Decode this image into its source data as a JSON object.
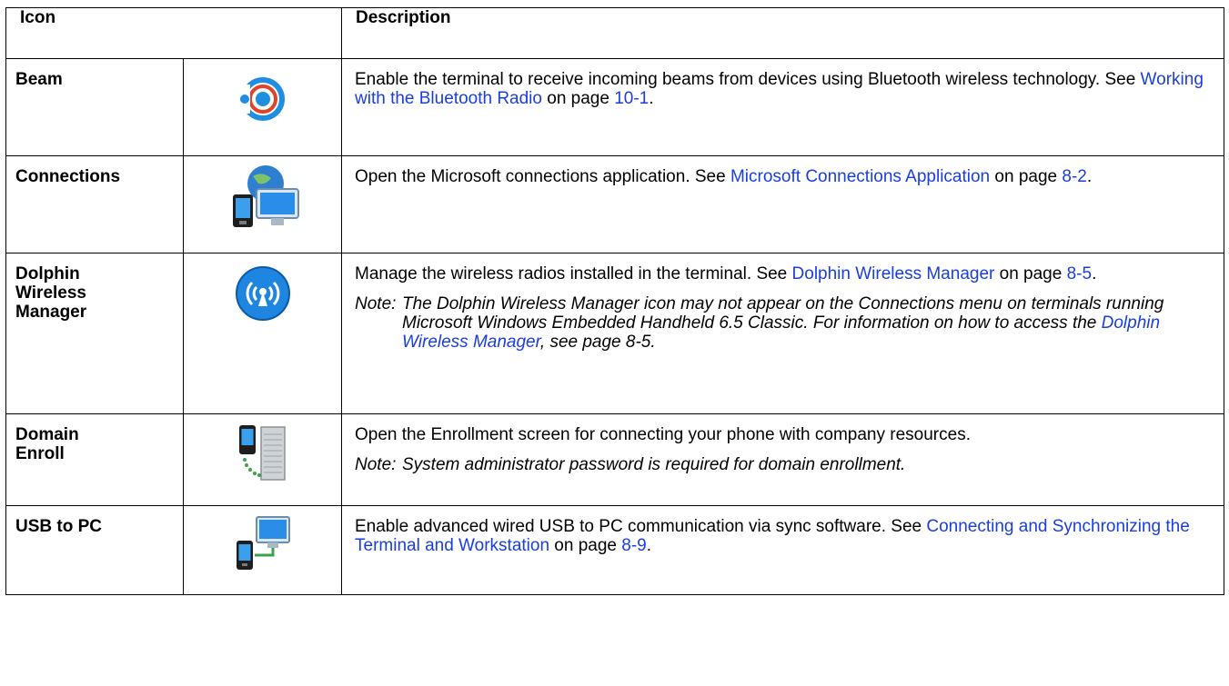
{
  "header": {
    "icon_col": "Icon",
    "description_col": "Description"
  },
  "rows": [
    {
      "name": "Beam",
      "icon": "beam-icon",
      "desc_before": "Enable the terminal to receive incoming beams from devices using Bluetooth wireless technology. See ",
      "link1": "Working with the Bluetooth Radio",
      "mid1": " on page ",
      "link2": "10-1",
      "after": "."
    },
    {
      "name": "Connections",
      "icon": "connections-icon",
      "desc_before": "Open the Microsoft connections application. See ",
      "link1": "Microsoft Connections Application",
      "mid1": " on page ",
      "link2": "8-2",
      "after": "."
    },
    {
      "name_line1": "Dolphin",
      "name_line2": "Wireless",
      "name_line3": "Manager",
      "icon": "wireless-manager-icon",
      "desc_before": "Manage the wireless radios installed in the terminal. See ",
      "link1": "Dolphin Wireless Manager",
      "mid1": " on page ",
      "link2": "8-5",
      "after": ".",
      "note_label": "Note:",
      "note_before": "The Dolphin Wireless Manager icon may not appear on the Connections menu on terminals running Microsoft Windows Embedded Handheld 6.5 Classic. For information on how to access the ",
      "note_link": "Dolphin Wireless Manager",
      "note_after": ", see page 8-5."
    },
    {
      "name_line1": "Domain",
      "name_line2": "Enroll",
      "icon": "domain-enroll-icon",
      "desc": "Open the Enrollment screen for connecting your phone with company resources.",
      "note_label": "Note:",
      "note": "System administrator password is required for domain enrollment."
    },
    {
      "name": "USB to PC",
      "icon": "usb-to-pc-icon",
      "desc_before": "Enable advanced wired USB to PC communication via sync software. See ",
      "link1": "Connecting and Synchronizing the Terminal and Workstation",
      "mid1": " on page ",
      "link2": "8-9",
      "after": "."
    }
  ],
  "colors": {
    "link": "#1a3de0",
    "border": "#000000"
  }
}
